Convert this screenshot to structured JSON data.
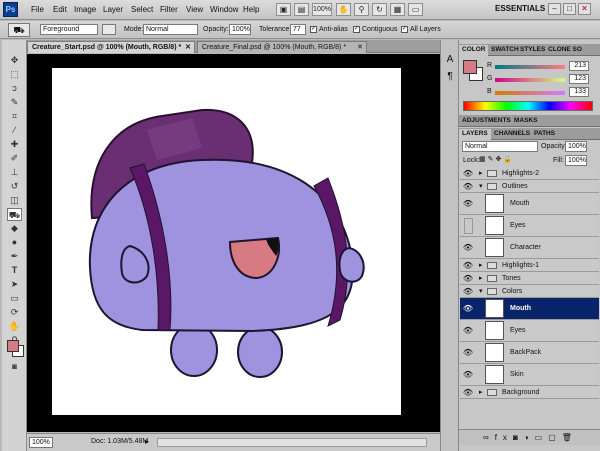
{
  "app": {
    "logo": "Ps"
  },
  "menu": [
    "File",
    "Edit",
    "Image",
    "Layer",
    "Select",
    "Filter",
    "View",
    "Window",
    "Help"
  ],
  "top_right": {
    "zoom": "100%",
    "workspace": "ESSENTIALS"
  },
  "options": {
    "fill_source": "Foreground",
    "mode_label": "Mode:",
    "mode_value": "Normal",
    "opacity_label": "Opacity:",
    "opacity_value": "100%",
    "tolerance_label": "Tolerance:",
    "tolerance_value": "77",
    "antialias_label": "Anti-alias",
    "contiguous_label": "Contiguous",
    "all_layers_label": "All Layers"
  },
  "tabs": [
    {
      "label": "Creature_Start.psd @ 100% (Mouth, RGB/8) *",
      "active": true
    },
    {
      "label": "Creature_Final.psd @ 100% (Mouth, RGB/8) *",
      "active": false
    }
  ],
  "status": {
    "zoom": "100%",
    "doc": "Doc: 1.03M/5.48M"
  },
  "color_panel": {
    "tabs": [
      "COLOR",
      "SWATCH",
      "STYLES",
      "CLONE SO"
    ],
    "r_label": "R",
    "r_value": "213",
    "g_label": "G",
    "g_value": "123",
    "b_label": "B",
    "b_value": "133",
    "foreground": "#d57b85"
  },
  "adjust_tabs": [
    "ADJUSTMENTS",
    "MASKS"
  ],
  "layers_panel": {
    "tabs": [
      "LAYERS",
      "CHANNELS",
      "PATHS"
    ],
    "blend": "Normal",
    "opacity_label": "Opacity:",
    "opacity_value": "100%",
    "lock_label": "Lock:",
    "fill_label": "Fill:",
    "fill_value": "100%",
    "layers": [
      {
        "name": "Highlights-2",
        "kind": "group",
        "visible": true
      },
      {
        "name": "Outlines",
        "kind": "group-open",
        "visible": true
      },
      {
        "name": "Mouth",
        "kind": "layer",
        "visible": true
      },
      {
        "name": "Eyes",
        "kind": "layer",
        "visible": false
      },
      {
        "name": "Character",
        "kind": "layer",
        "visible": true
      },
      {
        "name": "Highlights-1",
        "kind": "group",
        "visible": true
      },
      {
        "name": "Tones",
        "kind": "group",
        "visible": true
      },
      {
        "name": "Colors",
        "kind": "group-open",
        "visible": true
      },
      {
        "name": "Mouth",
        "kind": "layer",
        "visible": true,
        "selected": true
      },
      {
        "name": "Eyes",
        "kind": "layer",
        "visible": true
      },
      {
        "name": "BackPack",
        "kind": "layer",
        "visible": true
      },
      {
        "name": "Skin",
        "kind": "layer",
        "visible": true
      },
      {
        "name": "Background",
        "kind": "group",
        "visible": true
      }
    ]
  },
  "colors": {
    "body": "#9f92de",
    "backpack": "#6a2f72",
    "strap": "#5a1766",
    "mouth": "#d87a82",
    "selection": "#0a246a"
  }
}
